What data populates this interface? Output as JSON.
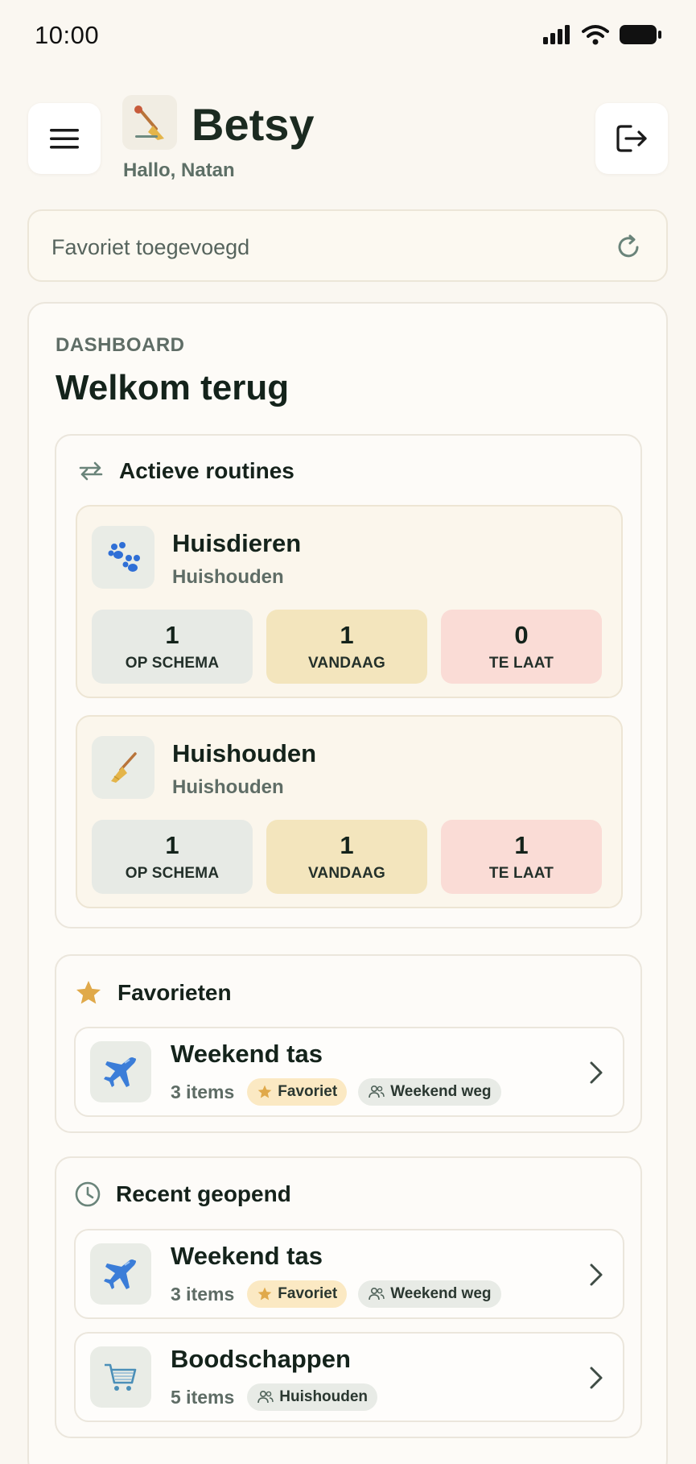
{
  "status": {
    "time": "10:00"
  },
  "header": {
    "app_name": "Betsy",
    "greeting": "Hallo, Natan"
  },
  "toast": {
    "message": "Favoriet toegevoegd"
  },
  "dashboard": {
    "eyebrow": "DASHBOARD",
    "title": "Welkom terug"
  },
  "routines": {
    "title": "Actieve routines",
    "items": [
      {
        "name": "Huisdieren",
        "category": "Huishouden",
        "icon": "paw-icon",
        "stats": [
          {
            "value": "1",
            "label": "OP SCHEMA",
            "color": "#e7eae5"
          },
          {
            "value": "1",
            "label": "VANDAAG",
            "color": "#f3e5bd"
          },
          {
            "value": "0",
            "label": "TE LAAT",
            "color": "#fadcd6"
          }
        ]
      },
      {
        "name": "Huishouden",
        "category": "Huishouden",
        "icon": "broom-icon",
        "stats": [
          {
            "value": "1",
            "label": "OP SCHEMA",
            "color": "#e7eae5"
          },
          {
            "value": "1",
            "label": "VANDAAG",
            "color": "#f3e5bd"
          },
          {
            "value": "1",
            "label": "TE LAAT",
            "color": "#fadcd6"
          }
        ]
      }
    ]
  },
  "favorites": {
    "title": "Favorieten",
    "items": [
      {
        "title": "Weekend tas",
        "count": "3 items",
        "fav_chip": "Favoriet",
        "group_chip": "Weekend weg",
        "icon": "airplane-icon"
      }
    ]
  },
  "recent": {
    "title": "Recent geopend",
    "items": [
      {
        "title": "Weekend tas",
        "count": "3 items",
        "fav_chip": "Favoriet",
        "group_chip": "Weekend weg",
        "icon": "airplane-icon"
      },
      {
        "title": "Boodschappen",
        "count": "5 items",
        "group_chip": "Huishouden",
        "icon": "shopping-cart-icon"
      }
    ]
  },
  "colors": {
    "background": "#faf7f1",
    "accent_star": "#e0a94a",
    "text_primary": "#14231b",
    "text_muted": "#5f6d66"
  }
}
